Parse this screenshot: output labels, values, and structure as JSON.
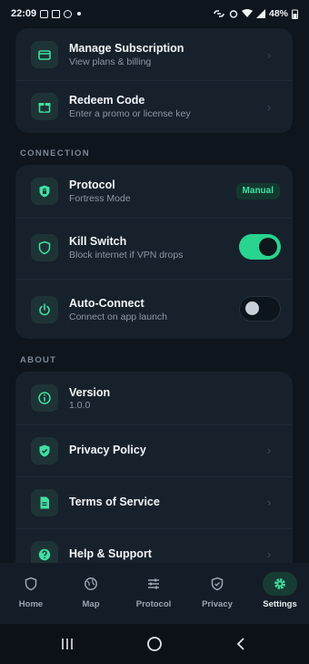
{
  "statusbar": {
    "time": "22:09",
    "battery": "48%"
  },
  "account_card": {
    "items": [
      {
        "title": "Manage Subscription",
        "subtitle": "View plans & billing",
        "icon": "card-icon"
      },
      {
        "title": "Redeem Code",
        "subtitle": "Enter a promo or license key",
        "icon": "gift-icon"
      }
    ]
  },
  "connection": {
    "section_label": "CONNECTION",
    "protocol": {
      "title": "Protocol",
      "subtitle": "Fortress Mode",
      "badge": "Manual",
      "icon": "shield-lock-icon"
    },
    "kill_switch": {
      "title": "Kill Switch",
      "subtitle": "Block internet if VPN drops",
      "enabled": true,
      "icon": "shield-icon"
    },
    "auto_connect": {
      "title": "Auto-Connect",
      "subtitle": "Connect on app launch",
      "enabled": false,
      "icon": "power-icon"
    }
  },
  "about": {
    "section_label": "ABOUT",
    "version": {
      "title": "Version",
      "value": "1.0.0",
      "icon": "info-icon"
    },
    "privacy_policy": {
      "title": "Privacy Policy",
      "icon": "shield-check-icon"
    },
    "terms": {
      "title": "Terms of Service",
      "icon": "document-icon"
    },
    "help": {
      "title": "Help & Support",
      "icon": "help-icon"
    }
  },
  "bottom_nav": {
    "items": [
      {
        "label": "Home",
        "icon": "shield-home-icon"
      },
      {
        "label": "Map",
        "icon": "globe-icon"
      },
      {
        "label": "Protocol",
        "icon": "sliders-icon"
      },
      {
        "label": "Privacy",
        "icon": "shield-check-icon"
      },
      {
        "label": "Settings",
        "icon": "gear-icon",
        "active": true
      }
    ]
  },
  "colors": {
    "accent": "#28d48e",
    "background": "#0e151d",
    "card": "#17212c"
  }
}
